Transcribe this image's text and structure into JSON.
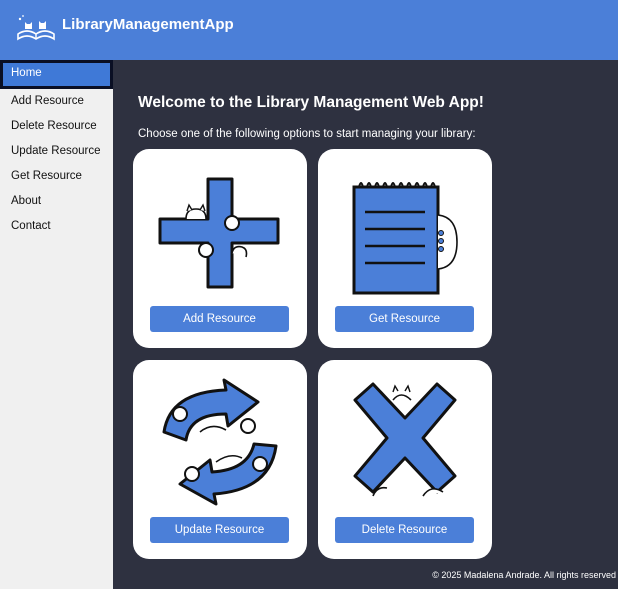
{
  "header": {
    "title": "LibraryManagementApp",
    "logo_icon": "book-cats-logo-icon"
  },
  "sidebar": {
    "items": [
      {
        "label": "Home",
        "active": true
      },
      {
        "label": "Add Resource"
      },
      {
        "label": "Delete Resource"
      },
      {
        "label": "Update Resource"
      },
      {
        "label": "Get Resource"
      },
      {
        "label": "About"
      },
      {
        "label": "Contact"
      }
    ]
  },
  "main": {
    "welcome": "Welcome to the Library Management Web App!",
    "subtitle": "Choose one of the following options to start managing your library:",
    "cards": [
      {
        "icon": "plus-cats-icon",
        "button": "Add Resource"
      },
      {
        "icon": "notepad-cat-icon",
        "button": "Get Resource"
      },
      {
        "icon": "refresh-arrows-cats-icon",
        "button": "Update Resource"
      },
      {
        "icon": "x-cross-cats-icon",
        "button": "Delete Resource"
      }
    ]
  },
  "footer": {
    "text": "© 2025 Madalena Andrade. All rights reserved"
  },
  "colors": {
    "header": "#4b7fd8",
    "background": "#2e3140",
    "sidebar": "#f0f0f0",
    "accent": "#3f79d7"
  }
}
